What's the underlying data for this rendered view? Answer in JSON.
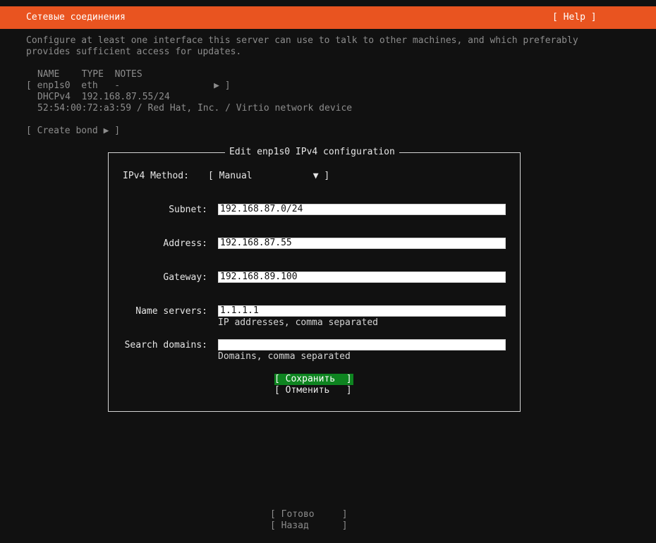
{
  "header": {
    "title": "Сетевые соединения",
    "help_label": "[ Help ]",
    "accent_color": "#e95420"
  },
  "intro": {
    "line1": "Configure at least one interface this server can use to talk to other machines, and which preferably",
    "line2": "provides sufficient access for updates."
  },
  "interfaces": {
    "headers": "NAME    TYPE  NOTES",
    "row": "[ enp1s0  eth   -                 ▶ ]",
    "dhcp": "DHCPv4  192.168.87.55/24",
    "device": "52:54:00:72:a3:59 / Red Hat, Inc. / Virtio network device"
  },
  "create_bond_label": "[ Create bond ▶ ]",
  "dialog": {
    "title": "Edit enp1s0 IPv4 configuration",
    "method_label": "IPv4 Method:",
    "method_value": "[ Manual           ▼ ]",
    "subnet_label": "Subnet:",
    "subnet_value": "192.168.87.0/24",
    "address_label": "Address:",
    "address_value": "192.168.87.55",
    "gateway_label": "Gateway:",
    "gateway_value": "192.168.89.100",
    "nameservers_label": "Name servers:",
    "nameservers_value": "1.1.1.1",
    "nameservers_help": "IP addresses, comma separated",
    "search_label": "Search domains:",
    "search_value": "",
    "search_help": "Domains, comma separated",
    "save_label": "[ Сохранить  ]",
    "cancel_label": "[ Отменить   ]",
    "save_color": "#0e8420"
  },
  "footer": {
    "done_label": "[ Готово     ]",
    "back_label": "[ Назад      ]"
  }
}
